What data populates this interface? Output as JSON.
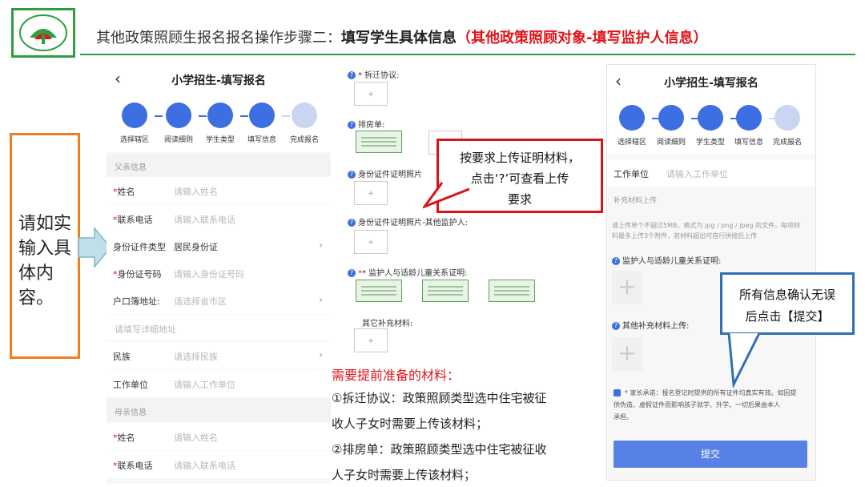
{
  "header": {
    "title_prefix": "其他政策照顾生报名报名操作步骤二：",
    "title_bold": "填写学生具体信息",
    "title_red": "（其他政策照顾对象-填写监护人信息）"
  },
  "colors": {
    "brand_green": "#2e9e3f",
    "accent_blue": "#3d6ee2",
    "alert_red": "#e0141a",
    "note_orange": "#f07d22"
  },
  "left_note": {
    "text": "请如实输入具体内容。"
  },
  "phone_left": {
    "back_icon": "chevron-left-icon",
    "title": "小学招生-填写报名",
    "steps": [
      "选择辖区",
      "阅读细则",
      "学生类型",
      "填写信息",
      "完成报名"
    ],
    "section_father": "父亲信息",
    "rows": [
      {
        "label": "姓名",
        "required": "*",
        "value": "请输入姓名",
        "chevron": ""
      },
      {
        "label": "联系电话",
        "required": "*",
        "value": "请输入联系电话",
        "chevron": ""
      },
      {
        "label": "身份证件类型",
        "required": "",
        "value": "居民身份证",
        "chevron": "›"
      },
      {
        "label": "身份证号码",
        "required": "*",
        "value": "请输入身份证号码",
        "chevron": ""
      },
      {
        "label": "户口簿地址:",
        "required": "",
        "value": "请选择省市区",
        "chevron": "›"
      }
    ],
    "detail_address": "请填写详细地址",
    "rows2": [
      {
        "label": "民族",
        "required": "",
        "value": "请选择民族",
        "chevron": "›"
      },
      {
        "label": "工作单位",
        "required": "",
        "value": "请输入工作单位",
        "chevron": ""
      }
    ],
    "section_mother": "母亲信息",
    "rows3": [
      {
        "label": "姓名",
        "required": "*",
        "value": "请输入姓名"
      },
      {
        "label": "联系电话",
        "required": "*",
        "value": "请输入联系电话"
      }
    ]
  },
  "middle": {
    "items": [
      {
        "label": "* 拆迁协议:"
      },
      {
        "label": "排房单:"
      },
      {
        "label": "身份证件证明照片"
      },
      {
        "label": "身份证件证明照片-其他监护人:"
      },
      {
        "label": "* 监护人与适龄儿童关系证明:"
      },
      {
        "label": "其它补充材料:"
      }
    ],
    "upload_plus": "+",
    "callout": {
      "line1": "按要求上传证明材料，",
      "line2": "点击‘?’可查看上传",
      "line3": "要求"
    },
    "requirements_title": "需要提前准备的材料：",
    "requirements": [
      "①拆迁协议：政策照顾类型选中住宅被征",
      "收人子女时需要上传该材料；",
      "②排房单：政策照顾类型选中住宅被征收",
      "人子女时需要上传该材料；"
    ]
  },
  "phone_right": {
    "title": "小学招生-填写报名",
    "steps": [
      "选择辖区",
      "阅读细则",
      "学生类型",
      "填写信息",
      "完成报名"
    ],
    "work_label": "工作单位",
    "work_placeholder": "请输入工作单位",
    "supplement_section": "补充材料上传",
    "upload_tip_1": "请上传单个不超过5MB，格式为 jpg / png / jpeg 的文件，每项材",
    "upload_tip_2": "料最多上传3个附件，若材料超出可自行拼接后上传",
    "relation_label": "监护人与适龄儿童关系证明:",
    "other_label": "其他补充材料上传:",
    "plus": "+",
    "promise_1": "* 家长承诺：报名登记时提供的所有证件均真实有效。如因提",
    "promise_2": "供伪造、虚假证件而影响孩子就学、升学，一切后果由本人",
    "promise_3": "承担。",
    "submit": "提交",
    "callout": {
      "line1": "所有信息确认无误",
      "line2": "后点击【提交】"
    }
  }
}
